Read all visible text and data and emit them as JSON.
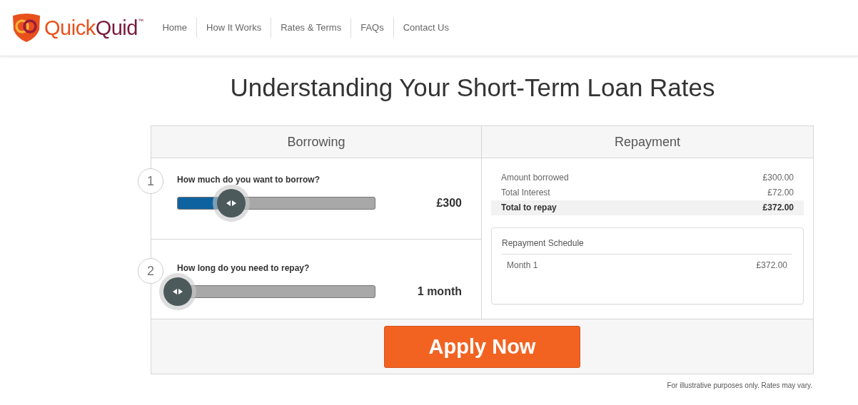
{
  "logo": {
    "parts": [
      {
        "text": "Quick",
        "color": "#e8501c"
      },
      {
        "text": "Quid",
        "color": "#7a1a3a"
      }
    ],
    "mark": "™"
  },
  "nav": [
    {
      "label": "Home"
    },
    {
      "label": "How It Works"
    },
    {
      "label": "Rates & Terms"
    },
    {
      "label": "FAQs"
    },
    {
      "label": "Contact Us"
    }
  ],
  "title": "Understanding Your Short-Term Loan Rates",
  "borrowing": {
    "heading": "Borrowing",
    "steps": [
      {
        "number": "1",
        "question": "How much do you want to borrow?",
        "level": 0.27,
        "reading": "£300"
      },
      {
        "number": "2",
        "question": "How long do you need to repay?",
        "level": 0,
        "reading": "1 month"
      }
    ]
  },
  "repayment": {
    "heading": "Repayment",
    "summary": [
      {
        "label": "Amount borrowed",
        "value": "£300.00",
        "total": false
      },
      {
        "label": "Total Interest",
        "value": "£72.00",
        "total": false
      },
      {
        "label": "Total to repay",
        "value": "£372.00",
        "total": true
      }
    ],
    "schedule": {
      "title": "Repayment Schedule",
      "rows": [
        {
          "label": "Month 1",
          "value": "£372.00"
        }
      ]
    }
  },
  "apply_button": "Apply Now",
  "note": "For illustrative purposes only. Rates may vary."
}
